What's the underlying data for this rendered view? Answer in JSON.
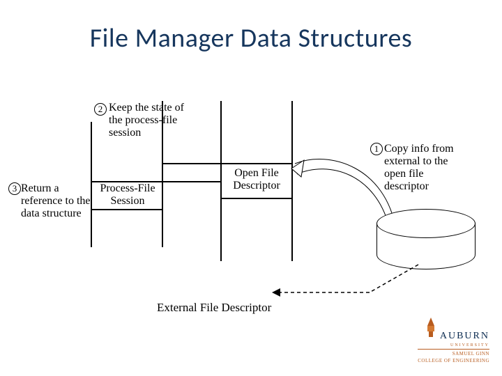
{
  "title": "File Manager Data Structures",
  "steps": {
    "s1": {
      "num": "1",
      "text": "Copy info from external to the open file descriptor"
    },
    "s2": {
      "num": "2",
      "text": "Keep the state of the process-file session"
    },
    "s3": {
      "num": "3",
      "text": "Return a reference to the data structure"
    }
  },
  "boxes": {
    "process_file_session": "Process-File Session",
    "open_file_descriptor": "Open File Descriptor",
    "external_file_descriptor": "External File Descriptor"
  },
  "logo": {
    "name": "AUBURN",
    "sub1": "UNIVERSITY",
    "sub2": "SAMUEL GINN",
    "sub3": "COLLEGE OF ENGINEERING"
  }
}
